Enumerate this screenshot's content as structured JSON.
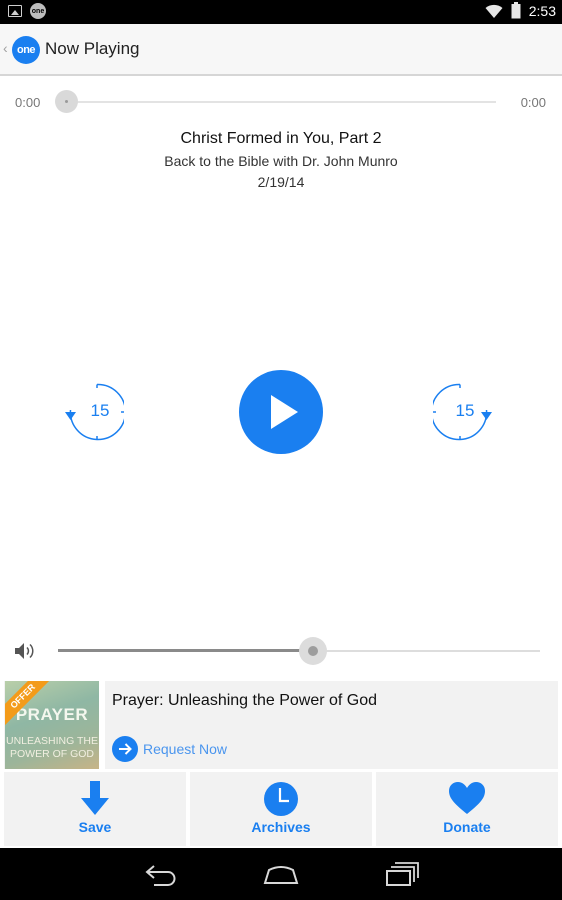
{
  "status_bar": {
    "time": "2:53",
    "icons": [
      "picture-icon",
      "one-app-icon",
      "wifi-icon",
      "battery-icon"
    ],
    "one_label": "one"
  },
  "action_bar": {
    "logo_text": "one",
    "title": "Now Playing"
  },
  "player": {
    "elapsed": "0:00",
    "duration": "0:00",
    "progress": 0,
    "episode_title": "Christ Formed in You, Part 2",
    "program": "Back to the Bible with Dr. John Munro",
    "date": "2/19/14",
    "skip_back_seconds": "15",
    "skip_forward_seconds": "15",
    "volume": 0.53
  },
  "offer": {
    "badge": "OFFER",
    "thumbnail_text": [
      "PRAYER",
      "UNLEASHING THE",
      "POWER OF GOD"
    ],
    "title": "Prayer: Unleashing the Power of God",
    "request_label": "Request Now"
  },
  "bottom_actions": [
    {
      "label": "Save",
      "icon": "download-arrow-icon"
    },
    {
      "label": "Archives",
      "icon": "clock-icon"
    },
    {
      "label": "Donate",
      "icon": "heart-icon"
    }
  ],
  "nav_bar": {
    "buttons": [
      "back-icon",
      "home-icon",
      "recents-icon"
    ]
  },
  "colors": {
    "accent": "#1a7ff0",
    "offer_badge": "#f39b1a",
    "card_bg": "#f2f2f2"
  }
}
